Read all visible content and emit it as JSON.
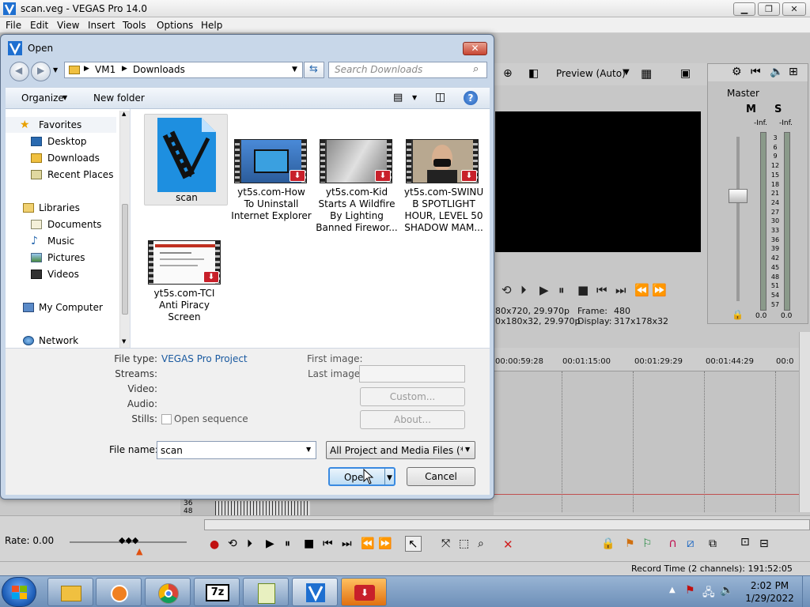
{
  "window": {
    "title": "scan.veg - VEGAS Pro 14.0",
    "menu": [
      "File",
      "Edit",
      "View",
      "Insert",
      "Tools",
      "Options",
      "Help"
    ],
    "controls": {
      "minimize": "▁",
      "maximize": "❐",
      "close": "✕"
    }
  },
  "vegas": {
    "preview_mode": "Preview (Auto)",
    "mixer_title": "Master",
    "mixer_m": "M",
    "mixer_s": "S",
    "meter_left": "-Inf.",
    "meter_right": "-Inf.",
    "meter_scale": [
      "3",
      "6",
      "9",
      "12",
      "15",
      "18",
      "21",
      "24",
      "27",
      "30",
      "33",
      "36",
      "39",
      "42",
      "45",
      "48",
      "51",
      "54",
      "57"
    ],
    "level_left": "0.0",
    "level_right": "0.0",
    "project_info": "80x720, 29.970p",
    "preview_info": "0x180x32, 29.970p",
    "frame_label": "Frame:",
    "frame_value": "480",
    "display_label": "Display:",
    "display_value": "317x178x32",
    "ruler": [
      "00:00:59:28",
      "00:01:15:00",
      "00:01:29:29",
      "00:01:44:29",
      "00:0"
    ],
    "track_level_top": "36",
    "track_level_bottom": "48",
    "rate": "Rate: 0.00",
    "record_time": "Record Time (2 channels): 191:52:05"
  },
  "dialog": {
    "title": "Open",
    "close": "✕",
    "breadcrumb": [
      "VM1",
      "Downloads"
    ],
    "search_placeholder": "Search Downloads",
    "organize": "Organize",
    "new_folder": "New folder",
    "nav": {
      "favorites": "Favorites",
      "desktop": "Desktop",
      "downloads": "Downloads",
      "recent": "Recent Places",
      "libraries": "Libraries",
      "documents": "Documents",
      "music": "Music",
      "pictures": "Pictures",
      "videos": "Videos",
      "computer": "My Computer",
      "network": "Network"
    },
    "files": [
      {
        "name": "scan"
      },
      {
        "name": "yt5s.com-How To Uninstall Internet Explorer",
        "l1": "yt5s.com-How",
        "l2": "To Uninstall",
        "l3": "Internet Explorer"
      },
      {
        "name": "yt5s.com-Kid Starts A Wildfire By Lighting Banned Firewor...",
        "l1": "yt5s.com-Kid",
        "l2": "Starts A Wildfire",
        "l3": "By Lighting",
        "l4": "Banned Firewor..."
      },
      {
        "name": "yt5s.com-SWINUB SPOTLIGHT HOUR, LEVEL 50 SHADOW MAM...",
        "l1": "yt5s.com-SWINU",
        "l2": "B SPOTLIGHT",
        "l3": "HOUR, LEVEL 50",
        "l4": "SHADOW MAM..."
      },
      {
        "name": "yt5s.com-TCI Anti Piracy Screen",
        "l1": "yt5s.com-TCI",
        "l2": "Anti Piracy",
        "l3": "Screen"
      }
    ],
    "details": {
      "file_type_label": "File type:",
      "file_type_value": "VEGAS Pro Project",
      "streams": "Streams:",
      "video": "Video:",
      "audio": "Audio:",
      "stills": "Stills:",
      "open_sequence": "Open sequence",
      "first_image": "First image:",
      "last_image": "Last image:",
      "custom": "Custom...",
      "about": "About..."
    },
    "file_name_label": "File name:",
    "file_name_value": "scan",
    "filter": "All Project and Media Files (*.ve",
    "open": "Open",
    "cancel": "Cancel"
  },
  "taskbar": {
    "time": "2:02 PM",
    "date": "1/29/2022",
    "sevenzip": "7z"
  }
}
